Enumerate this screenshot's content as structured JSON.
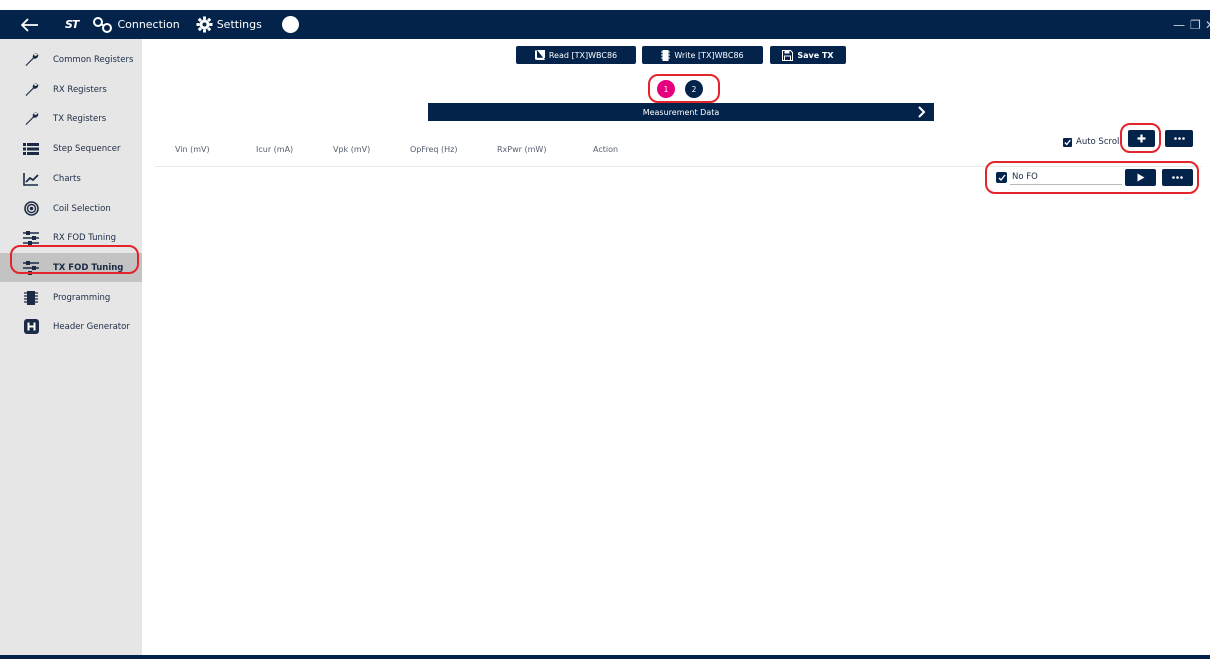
{
  "titlebar": {
    "logo": "ST",
    "connection_label": "Connection",
    "settings_label": "Settings",
    "help_label": "?",
    "minimize": "—",
    "maximize": "❐",
    "close": "✕"
  },
  "sidebar": {
    "items": [
      {
        "label": "Common Registers",
        "icon": "wrench-icon"
      },
      {
        "label": "RX Registers",
        "icon": "wrench-icon"
      },
      {
        "label": "TX Registers",
        "icon": "wrench-icon"
      },
      {
        "label": "Step Sequencer",
        "icon": "list-icon"
      },
      {
        "label": "Charts",
        "icon": "chart-icon"
      },
      {
        "label": "Coil Selection",
        "icon": "target-icon"
      },
      {
        "label": "RX FOD Tuning",
        "icon": "sliders-icon"
      },
      {
        "label": "TX FOD Tuning",
        "icon": "sliders-icon"
      },
      {
        "label": "Programming",
        "icon": "chip-icon"
      },
      {
        "label": "Header Generator",
        "icon": "h-icon"
      }
    ],
    "active_index": 7
  },
  "toolbar": {
    "read_label": "Read [TX]WBC86",
    "write_label": "Write [TX]WBC86",
    "save_label": "Save TX"
  },
  "pager": {
    "page1": "1",
    "page2": "2",
    "active": 1
  },
  "measurement": {
    "title": "Measurement Data"
  },
  "table": {
    "columns": [
      "Vin (mV)",
      "Icur (mA)",
      "Vpk (mV)",
      "OpFreq (Hz)",
      "RxPwr (mW)",
      "Action"
    ]
  },
  "controls": {
    "auto_scroll_label": "Auto Scroll",
    "auto_scroll_checked": true,
    "fo_value": "No FO",
    "fo_checked": true
  },
  "colors": {
    "navy": "#03234b",
    "pink": "#e6007e",
    "highlight_red": "#e3242b",
    "sidebar_bg": "#e6e6e6",
    "sidebar_active": "#c3c3c3"
  }
}
